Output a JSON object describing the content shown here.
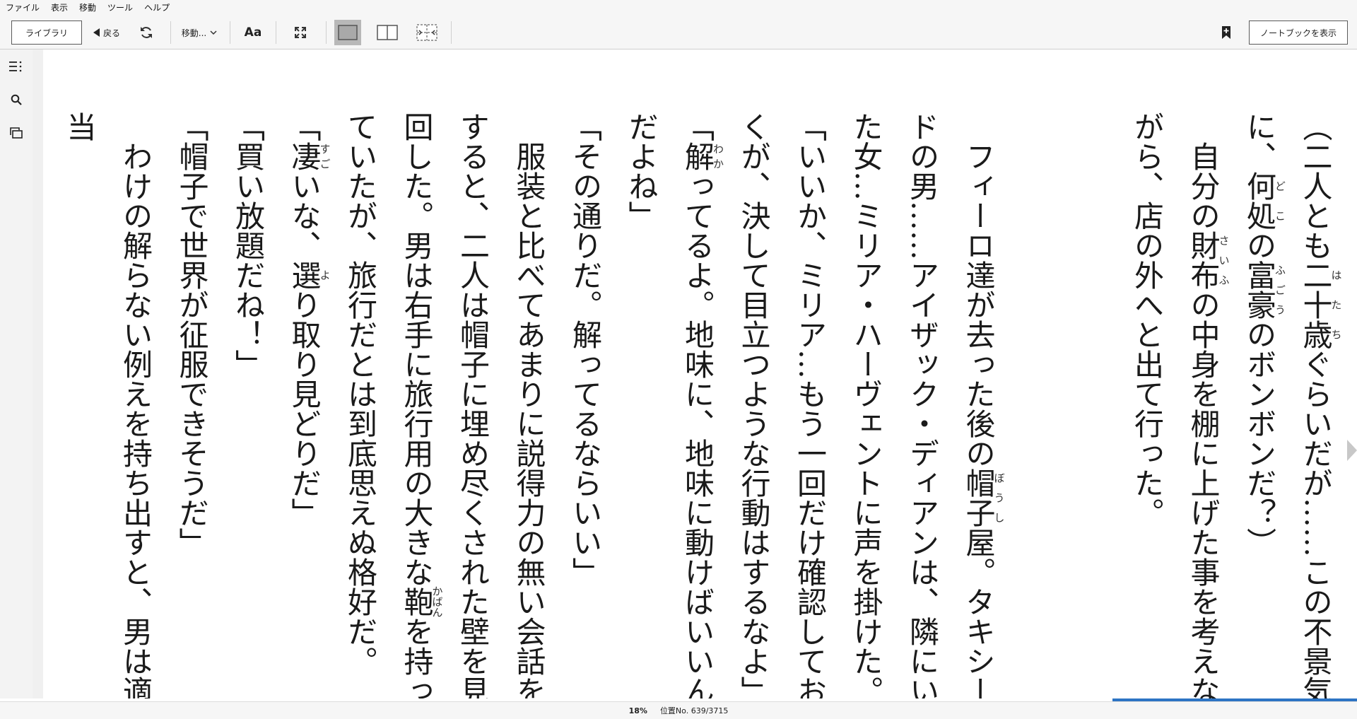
{
  "menu": [
    "ファイル",
    "表示",
    "移動",
    "ツール",
    "ヘルプ"
  ],
  "toolbar": {
    "library_label": "ライブラリ",
    "back_label": "戻る",
    "goto_label": "移動...",
    "font_label": "Aa",
    "notebook_label": "ノートブックを表示"
  },
  "status": {
    "percent": "18%",
    "location": "位置No. 639/3715",
    "progress_fraction": 0.18
  },
  "colors": {
    "accent": "#2d74c4",
    "selected_layout_bg": "#b8b8b8"
  },
  "icons": [
    "refresh-icon",
    "expand-icon",
    "single-page-layout-icon",
    "two-page-layout-icon",
    "grid-layout-icon",
    "bookmark-add-icon",
    "toc-icon",
    "search-icon",
    "cards-icon",
    "next-page-icon"
  ],
  "book": {
    "p1a": "（二人とも",
    "p1_ruby1_base": "二十歳",
    "p1_ruby1_rt": "はたち",
    "p1b": "ぐらいだが……この不景気に、",
    "p1_ruby2_base": "何処",
    "p1_ruby2_rt": "どこ",
    "p1c": "の",
    "p1_ruby3_base": "富豪",
    "p1_ruby3_rt": "ふごう",
    "p1d": "のボンボンだ？）",
    "p2a": "自分の",
    "p2_ruby_base": "財布",
    "p2_ruby_rt": "さいふ",
    "p2b": "の中身を棚に上げた事を考えながら、店の外へと出て行った。",
    "p3a": "フィーロ達が去った後の",
    "p3_ruby_base": "帽子",
    "p3_ruby_rt": "ぼうし",
    "p3b": "屋。タキシードの男……アイザック・ディアンは、隣にいた女…ミリア・ハーヴェントに声を掛けた。",
    "p4": "「いいか、ミリア…もう一回だけ確認しておくが、決して目立つような行動はするなよ」",
    "p5a": "「",
    "p5_ruby_base": "解",
    "p5_ruby_rt": "わか",
    "p5b": "ってるよ。地味に、地味に動けばいいんだよね」",
    "p6": "「その通りだ。解ってるならいい」",
    "p7a": "服装と比べてあまりに説得力の無い会話をすると、二人は帽子に埋め尽くされた壁を見回した。男は右手に旅行用の大きな",
    "p7_ruby_base": "鞄",
    "p7_ruby_rt": "かばん",
    "p7b": "を持っていたが、旅行だとは到底思えぬ格好だ。",
    "p8a": "「",
    "p8_ruby1_base": "凄",
    "p8_ruby1_rt": "すご",
    "p8b": "いな、",
    "p8_ruby2_base": "選",
    "p8_ruby2_rt": "よ",
    "p8c": "り取り見どりだ」",
    "p9": "「買い放題だね！」",
    "p10": "「帽子で世界が征服できそうだ」",
    "p11": "わけの解らない例えを持ち出すと、男は適当"
  }
}
